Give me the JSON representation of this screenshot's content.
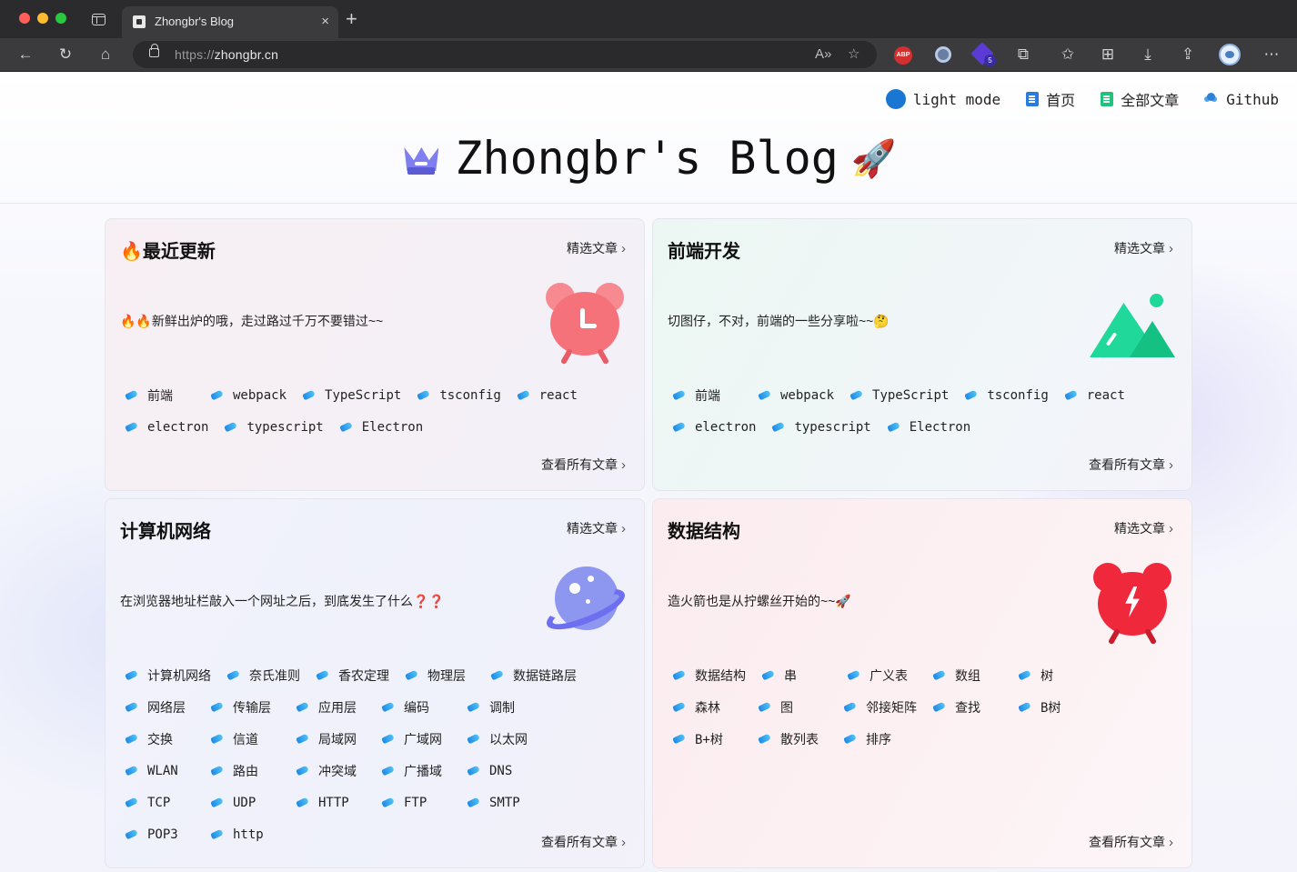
{
  "browser": {
    "tab_title": "Zhongbr's Blog",
    "tab_close": "×",
    "new_tab": "+",
    "url_scheme": "https://",
    "url_host": "zhongbr.cn",
    "abp_label": "ABP",
    "ext_badge": "5",
    "icons": {
      "back": "←",
      "reload": "↻",
      "home": "⌂",
      "read_aloud": "A»",
      "add_favorite": "☆",
      "extensions": "⧉",
      "favorites": "✩",
      "collections": "⊞",
      "downloads": "⤓",
      "share": "⇪",
      "more": "⋯"
    }
  },
  "nav": {
    "mode_label": "light mode",
    "home_label": "首页",
    "all_posts_label": "全部文章",
    "github_label": "Github",
    "mode_color": "#1976d2"
  },
  "site": {
    "title": "Zhongbr's Blog",
    "rocket": "🚀"
  },
  "cards": [
    {
      "title": "🔥最近更新",
      "featured_label": "精选文章",
      "desc": "🔥🔥新鲜出炉的哦，走过路过千万不要错过~~",
      "all_label": "查看所有文章",
      "tags": [
        "前端",
        "webpack",
        "TypeScript",
        "tsconfig",
        "react",
        "electron",
        "typescript",
        "Electron"
      ]
    },
    {
      "title": "前端开发",
      "featured_label": "精选文章",
      "desc": "切图仔，不对，前端的一些分享啦~~🤔",
      "all_label": "查看所有文章",
      "tags": [
        "前端",
        "webpack",
        "TypeScript",
        "tsconfig",
        "react",
        "electron",
        "typescript",
        "Electron"
      ]
    },
    {
      "title": "计算机网络",
      "featured_label": "精选文章",
      "desc": "在浏览器地址栏敲入一个网址之后，到底发生了什么❓❓",
      "all_label": "查看所有文章",
      "tags": [
        "计算机网络",
        "奈氏准则",
        "香农定理",
        "物理层",
        "数据链路层",
        "网络层",
        "传输层",
        "应用层",
        "编码",
        "调制",
        "交换",
        "信道",
        "局域网",
        "广域网",
        "以太网",
        "WLAN",
        "路由",
        "冲突域",
        "广播域",
        "DNS",
        "TCP",
        "UDP",
        "HTTP",
        "FTP",
        "SMTP",
        "POP3",
        "http"
      ]
    },
    {
      "title": "数据结构",
      "featured_label": "精选文章",
      "desc": "造火箭也是从拧螺丝开始的~~🚀",
      "all_label": "查看所有文章",
      "tags": [
        "数据结构",
        "串",
        "广义表",
        "数组",
        "树",
        "森林",
        "图",
        "邻接矩阵",
        "查找",
        "B树",
        "B+树",
        "散列表",
        "排序"
      ]
    }
  ],
  "colors": {
    "clock_recent": "#f5727a",
    "clock_recent_ear": "#f78a91",
    "clock_ds": "#f0283c",
    "mountain": "#1fd89a",
    "planet": "#8e97f0",
    "tag_icon": "#1e88e5"
  }
}
